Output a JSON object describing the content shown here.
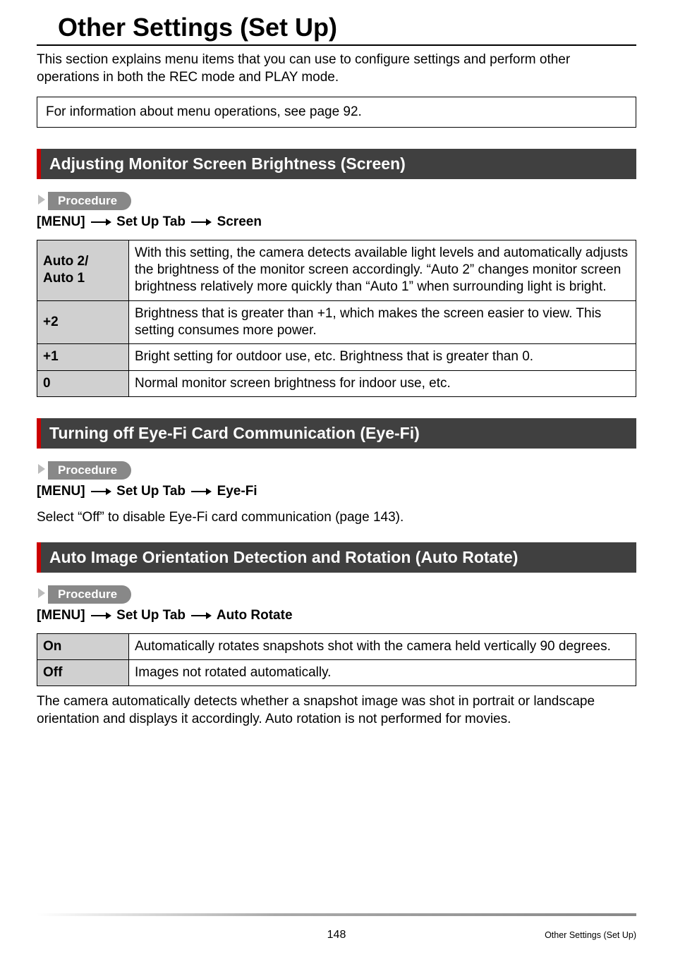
{
  "page": {
    "title": "Other Settings (Set Up)",
    "intro": "This section explains menu items that you can use to configure settings and perform other operations in both the REC mode and PLAY mode.",
    "info_box": "For information about menu operations, see page 92.",
    "page_number": "148",
    "footer_title": "Other Settings (Set Up)"
  },
  "labels": {
    "procedure": "Procedure",
    "menu": "[MENU]",
    "setup_tab": "Set Up Tab"
  },
  "sections": {
    "screen": {
      "heading": "Adjusting Monitor Screen Brightness (Screen)",
      "path_target": "Screen",
      "rows": [
        {
          "label": "Auto 2/\nAuto 1",
          "desc": "With this setting, the camera detects available light levels and automatically adjusts the brightness of the monitor screen accordingly. “Auto 2” changes monitor screen brightness relatively more quickly than “Auto 1” when surrounding light is bright."
        },
        {
          "label": "+2",
          "desc": "Brightness that is greater than +1, which makes the screen easier to view. This setting consumes more power."
        },
        {
          "label": "+1",
          "desc": "Bright setting for outdoor use, etc. Brightness that is greater than 0."
        },
        {
          "label": "0",
          "desc": "Normal monitor screen brightness for indoor use, etc."
        }
      ]
    },
    "eyefi": {
      "heading": "Turning off Eye-Fi Card Communication (Eye-Fi)",
      "path_target": "Eye-Fi",
      "para": "Select “Off” to disable Eye-Fi card communication (page 143)."
    },
    "rotate": {
      "heading": "Auto Image Orientation Detection and Rotation (Auto Rotate)",
      "path_target": "Auto Rotate",
      "rows": [
        {
          "label": "On",
          "desc": "Automatically rotates snapshots shot with the camera held vertically 90 degrees."
        },
        {
          "label": "Off",
          "desc": "Images not rotated automatically."
        }
      ],
      "after": "The camera automatically detects whether a snapshot image was shot in portrait or landscape orientation and displays it accordingly. Auto rotation is not performed for movies."
    }
  }
}
